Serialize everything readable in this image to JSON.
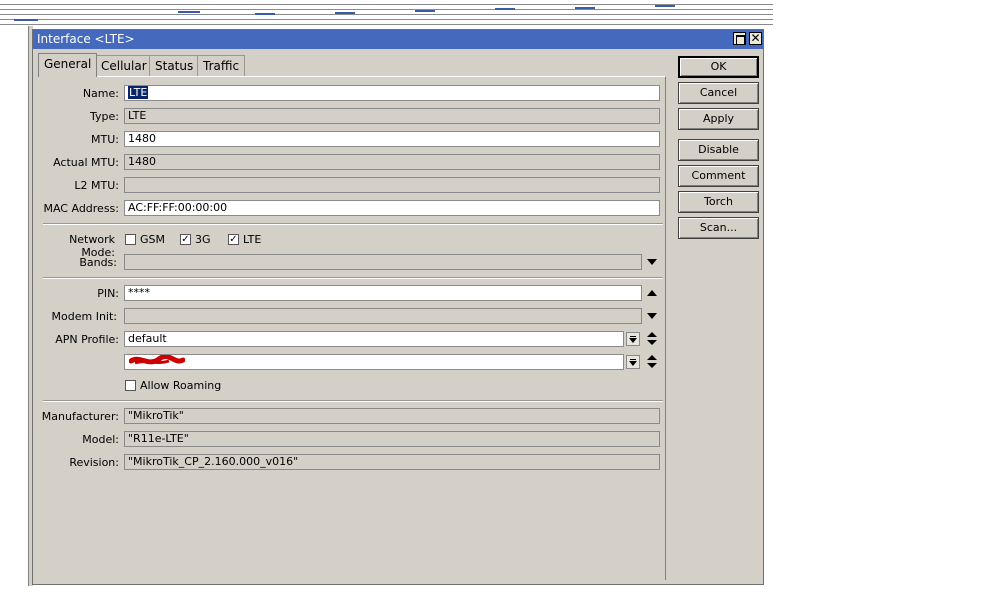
{
  "window": {
    "title": "Interface <LTE>"
  },
  "tabs": [
    "General",
    "Cellular",
    "Status",
    "Traffic"
  ],
  "fields": {
    "name": {
      "label": "Name:",
      "value": "LTE"
    },
    "type": {
      "label": "Type:",
      "value": "LTE"
    },
    "mtu": {
      "label": "MTU:",
      "value": "1480"
    },
    "actual_mtu": {
      "label": "Actual MTU:",
      "value": "1480"
    },
    "l2_mtu": {
      "label": "L2 MTU:",
      "value": ""
    },
    "mac": {
      "label": "MAC Address:",
      "value": "AC:FF:FF:00:00:00"
    },
    "network_mode": {
      "label": "Network Mode:",
      "options": [
        {
          "label": "GSM",
          "checked": false
        },
        {
          "label": "3G",
          "checked": true
        },
        {
          "label": "LTE",
          "checked": true
        }
      ]
    },
    "bands": {
      "label": "Bands:",
      "value": ""
    },
    "pin": {
      "label": "PIN:",
      "value": "****"
    },
    "modem_init": {
      "label": "Modem Init:",
      "value": ""
    },
    "apn_profile": {
      "label": "APN Profile:",
      "value": "default"
    },
    "allow_roaming": {
      "label": "Allow Roaming",
      "checked": false
    },
    "manufacturer": {
      "label": "Manufacturer:",
      "value": "\"MikroTik\""
    },
    "model": {
      "label": "Model:",
      "value": "\"R11e-LTE\""
    },
    "revision": {
      "label": "Revision:",
      "value": "\"MikroTik_CP_2.160.000_v016\""
    }
  },
  "buttons": {
    "ok": "OK",
    "cancel": "Cancel",
    "apply": "Apply",
    "disable": "Disable",
    "comment": "Comment",
    "torch": "Torch",
    "scan": "Scan..."
  },
  "colors": {
    "titlebar": "#4469bd",
    "window_bg": "#d4d0c8",
    "redaction": "#cc0000"
  }
}
